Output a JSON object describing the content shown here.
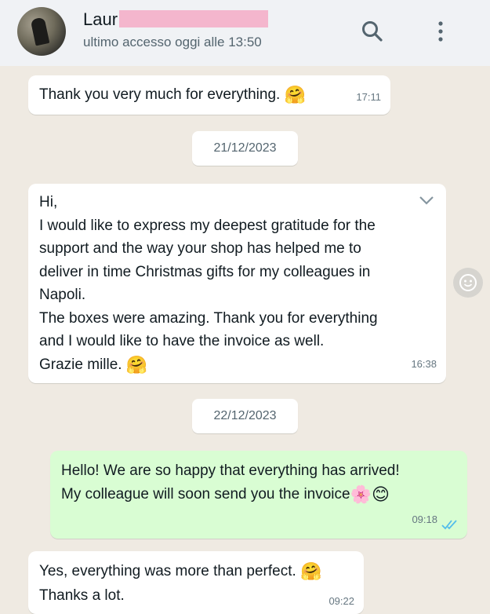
{
  "header": {
    "contact_name": "Laur",
    "last_seen": "ultimo accesso oggi alle 13:50",
    "search_icon": "search-icon",
    "menu_icon": "vertical-dots-menu-icon"
  },
  "messages": [
    {
      "direction": "in",
      "text": "Thank you very much for everything.",
      "emoji": "🤗",
      "time": "17:11"
    },
    {
      "type": "date",
      "text": "21/12/2023"
    },
    {
      "direction": "in",
      "text": "Hi,\nI would like to express my deepest gratitude for the\nsupport and the way your shop has helped me to\ndeliver in time Christmas gifts for my colleagues in\nNapoli.\nThe boxes were amazing. Thank you for everything\nand I would like to have the invoice as well.\nGrazie mille.",
      "emoji": "🤗",
      "time": "16:38"
    },
    {
      "type": "date",
      "text": "22/12/2023"
    },
    {
      "direction": "out",
      "text": "Hello! We are so happy that everything has arrived!\nMy colleague will soon send you the invoice",
      "emoji": "🌸😊",
      "time": "09:18",
      "status": "read"
    },
    {
      "direction": "in",
      "text": "Yes, everything was more than perfect.",
      "text2": "Thanks a lot.",
      "emoji": "🤗",
      "time": "09:22"
    }
  ],
  "colors": {
    "chat_background": "#efeae2",
    "incoming_bubble": "#ffffff",
    "outgoing_bubble": "#d9fdd3",
    "read_ticks": "#53bdeb",
    "redaction": "#f4b6cd"
  }
}
